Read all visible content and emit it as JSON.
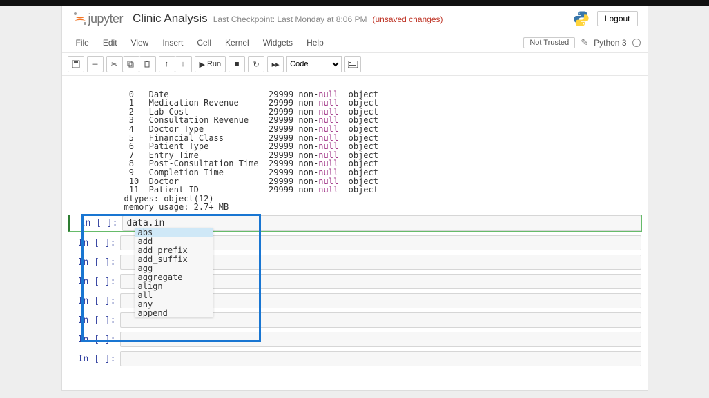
{
  "header": {
    "logo_text": "jupyter",
    "notebook_title": "Clinic Analysis",
    "checkpoint": "Last Checkpoint: Last Monday at 8:06 PM",
    "unsaved": "(unsaved changes)",
    "logout": "Logout"
  },
  "menubar": {
    "items": [
      "File",
      "Edit",
      "View",
      "Insert",
      "Cell",
      "Kernel",
      "Widgets",
      "Help"
    ],
    "not_trusted": "Not Trusted",
    "kernel": "Python 3"
  },
  "toolbar": {
    "run": "Run",
    "cell_type": "Code"
  },
  "output": {
    "rows": [
      {
        "idx": "---",
        "col": "------",
        "nn": "--------------",
        "dt": "------"
      },
      {
        "idx": " 0 ",
        "col": "Date                  ",
        "nn": "29999 non-null",
        "dt": "object"
      },
      {
        "idx": " 1 ",
        "col": "Medication Revenue    ",
        "nn": "29999 non-null",
        "dt": "object"
      },
      {
        "idx": " 2 ",
        "col": "Lab Cost              ",
        "nn": "29999 non-null",
        "dt": "object"
      },
      {
        "idx": " 3 ",
        "col": "Consultation Revenue  ",
        "nn": "29999 non-null",
        "dt": "object"
      },
      {
        "idx": " 4 ",
        "col": "Doctor Type           ",
        "nn": "29999 non-null",
        "dt": "object"
      },
      {
        "idx": " 5 ",
        "col": "Financial Class       ",
        "nn": "29999 non-null",
        "dt": "object"
      },
      {
        "idx": " 6 ",
        "col": "Patient Type          ",
        "nn": "29999 non-null",
        "dt": "object"
      },
      {
        "idx": " 7 ",
        "col": "Entry Time            ",
        "nn": "29999 non-null",
        "dt": "object"
      },
      {
        "idx": " 8 ",
        "col": "Post-Consultation Time",
        "nn": "29999 non-null",
        "dt": "object"
      },
      {
        "idx": " 9 ",
        "col": "Completion Time       ",
        "nn": "29999 non-null",
        "dt": "object"
      },
      {
        "idx": " 10",
        "col": "Doctor                ",
        "nn": "29999 non-null",
        "dt": "object"
      },
      {
        "idx": " 11",
        "col": "Patient ID            ",
        "nn": "29999 non-null",
        "dt": "object"
      }
    ],
    "dtypes": "dtypes: object(12)",
    "memory": "memory usage: 2.7+ MB"
  },
  "active_cell": {
    "prompt": "In [ ]:",
    "content": "data.in"
  },
  "empty_prompt": "In [ ]:",
  "autocomplete": {
    "items": [
      "abs",
      "add",
      "add_prefix",
      "add_suffix",
      "agg",
      "aggregate",
      "align",
      "all",
      "any",
      "append"
    ],
    "selected_index": 0
  }
}
